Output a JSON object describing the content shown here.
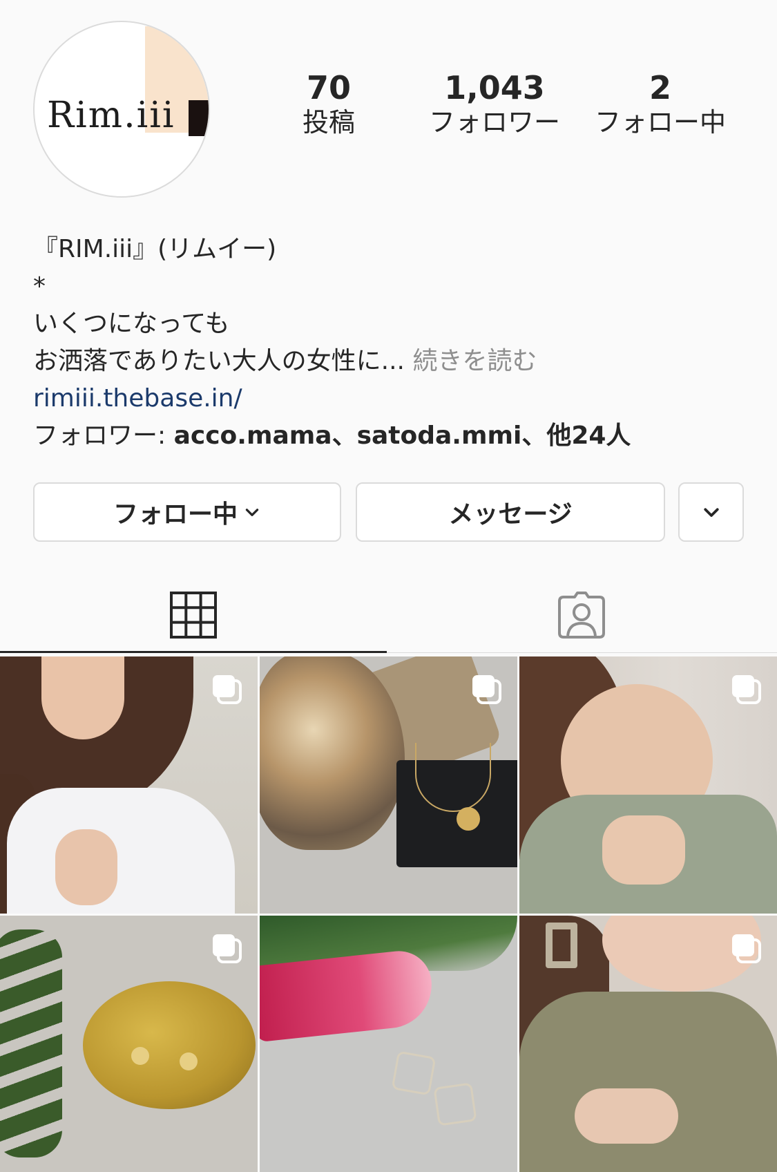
{
  "profile": {
    "avatar_logo": "Rim.iii",
    "stats": [
      {
        "value": "70",
        "label": "投稿"
      },
      {
        "value": "1,043",
        "label": "フォロワー"
      },
      {
        "value": "2",
        "label": "フォロー中"
      }
    ]
  },
  "bio": {
    "name": "『RIM.iii』(リムイー)",
    "line2": "*",
    "line3": "いくつになっても",
    "line4": "お洒落でありたい大人の女性に...",
    "more": "続きを読む",
    "link": "rimiii.thebase.in/",
    "followers_prefix": "フォロワー: ",
    "followers_names": "acco.mama、satoda.mmi、他24人"
  },
  "buttons": {
    "following": "フォロー中",
    "message": "メッセージ"
  },
  "tabs": {
    "grid_icon": "grid-icon",
    "tagged_icon": "tagged-person-icon",
    "active": "grid"
  },
  "posts": [
    {
      "type": "carousel"
    },
    {
      "type": "carousel"
    },
    {
      "type": "carousel"
    },
    {
      "type": "carousel"
    },
    {
      "type": "single"
    },
    {
      "type": "carousel"
    }
  ],
  "colors": {
    "link": "#1b3a6b",
    "muted": "#8e8e8e",
    "border": "#dbdbdb"
  }
}
